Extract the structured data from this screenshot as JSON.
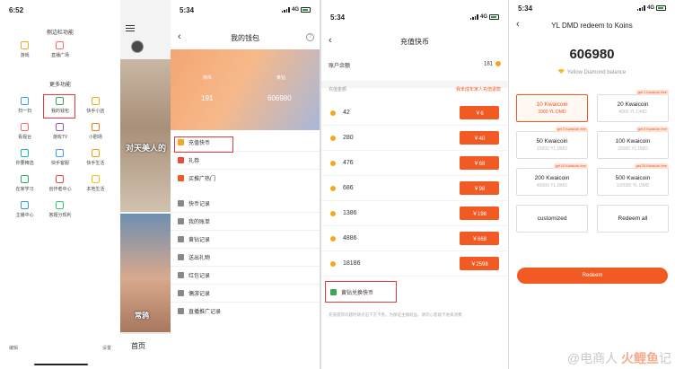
{
  "panel1": {
    "time": "6:52",
    "section_common": "侧边栏功能",
    "common": [
      {
        "label": "游戏",
        "icon": "game-icon",
        "color": "#f5a623"
      },
      {
        "label": "直播广场",
        "icon": "live-icon",
        "color": "#ff6b6b"
      }
    ],
    "section_more": "更多功能",
    "more": [
      {
        "label": "扫一扫",
        "icon": "scan-icon",
        "color": "#3b9cf5"
      },
      {
        "label": "我的钱包",
        "icon": "wallet-icon",
        "color": "#3aa654"
      },
      {
        "label": "快手小店",
        "icon": "shop-icon",
        "color": "#f5a623"
      },
      {
        "label": "看视台",
        "icon": "tv-icon",
        "color": "#ff6b6b"
      },
      {
        "label": "游戏TV",
        "icon": "game-tv-icon",
        "color": "#9b59b6"
      },
      {
        "label": "小剧场",
        "icon": "theater-icon",
        "color": "#e67e22"
      },
      {
        "label": "你要精选",
        "icon": "select-icon",
        "color": "#1abc9c"
      },
      {
        "label": "快手客服",
        "icon": "service-icon",
        "color": "#3b9cf5"
      },
      {
        "label": "快手生活",
        "icon": "life-icon",
        "color": "#f39c12"
      },
      {
        "label": "在家学习",
        "icon": "study-icon",
        "color": "#27ae60"
      },
      {
        "label": "创作者中心",
        "icon": "creator-icon",
        "color": "#e74c3c"
      },
      {
        "label": "本地生活",
        "icon": "local-icon",
        "color": "#f1c40f"
      },
      {
        "label": "主播中心",
        "icon": "anchor-icon",
        "color": "#3498db"
      },
      {
        "label": "答题分现利",
        "icon": "quiz-icon",
        "color": "#2ecc71"
      }
    ],
    "footer_left": "编辑",
    "footer_right": "设置"
  },
  "panel2": {
    "caption1": "对天美人的",
    "caption2": "常鸦",
    "bottom_tab": "首页"
  },
  "panel3": {
    "time": "5:34",
    "network": "4G",
    "title": "我的钱包",
    "info": "?",
    "coin_label": "快币",
    "coin_value": "191",
    "diamond_label": "黄钻",
    "diamond_value": "606980",
    "menu": [
      {
        "label": "充值快币",
        "icon": "coin-icon",
        "color": "#f2a81d"
      },
      {
        "label": "礼券",
        "icon": "coupon-icon",
        "color": "#e74c3c"
      },
      {
        "label": "买推广热门",
        "icon": "fire-icon",
        "color": "#f15a22"
      },
      {
        "label": "快币记录",
        "icon": "record-icon",
        "color": "#888888"
      },
      {
        "label": "我的账单",
        "icon": "bill-icon",
        "color": "#888888"
      },
      {
        "label": "黄钻记录",
        "icon": "diamond-record-icon",
        "color": "#888888"
      },
      {
        "label": "送出礼物",
        "icon": "gift-icon",
        "color": "#888888"
      },
      {
        "label": "红包记录",
        "icon": "redpacket-icon",
        "color": "#888888"
      },
      {
        "label": "偶游记录",
        "icon": "game-record-icon",
        "color": "#888888"
      },
      {
        "label": "直播推广记录",
        "icon": "promo-record-icon",
        "color": "#888888"
      }
    ]
  },
  "panel4": {
    "time": "5:34",
    "network": "4G",
    "title": "充值快币",
    "balance_label": "账户余额",
    "balance_value": "181",
    "amount_label": "充值金额",
    "amount_note": "我未成年家人充值退款",
    "options": [
      {
        "amount": "42",
        "price": "￥6"
      },
      {
        "amount": "280",
        "price": "￥40"
      },
      {
        "amount": "476",
        "price": "￥68"
      },
      {
        "amount": "686",
        "price": "￥98"
      },
      {
        "amount": "1386",
        "price": "￥198"
      },
      {
        "amount": "4886",
        "price": "￥668"
      },
      {
        "amount": "18186",
        "price": "￥2598"
      }
    ],
    "exchange_label": "黄钻兑换快币",
    "footnote": "充值遇到问题时请点击下方卡券，为保证主播权益，请勿心客观卡进来消费"
  },
  "panel5": {
    "time": "5:34",
    "network": "4G",
    "title": "YL DMD redeem to Koins",
    "balance": "606980",
    "balance_label": "Yellow Diamond balance",
    "options": [
      {
        "title": "10 Kwaicoin",
        "sub": "2000 YL DMD",
        "tag": "",
        "selected": true
      },
      {
        "title": "20 Kwaicoin",
        "sub": "4000 YL DMD",
        "tag": "get 1 Kwaicoin free",
        "selected": false
      },
      {
        "title": "50 Kwaicoin",
        "sub": "10000 YL DMD",
        "tag": "get 2 Kwaicoin free",
        "selected": false
      },
      {
        "title": "100 Kwaicoin",
        "sub": "20000 YL DMD",
        "tag": "get 5 Kwaicoin free",
        "selected": false
      },
      {
        "title": "200 Kwaicoin",
        "sub": "40000 YL DMD",
        "tag": "get 10 Kwaicoin free",
        "selected": false
      },
      {
        "title": "500 Kwaicoin",
        "sub": "100000 YL DMD",
        "tag": "get 25 Kwaicoin free",
        "selected": false
      },
      {
        "title": "customized",
        "sub": "",
        "tag": "",
        "selected": false
      },
      {
        "title": "Redeem all",
        "sub": "",
        "tag": "",
        "selected": false
      }
    ],
    "redeem_label": "Redeem"
  },
  "watermark": {
    "text": "@电商人",
    "logo": "火鲤鱼",
    "tail": "记"
  },
  "colors": {
    "accent": "#f15a22",
    "highlight": "#e23a3a",
    "coin": "#f2a81d"
  }
}
